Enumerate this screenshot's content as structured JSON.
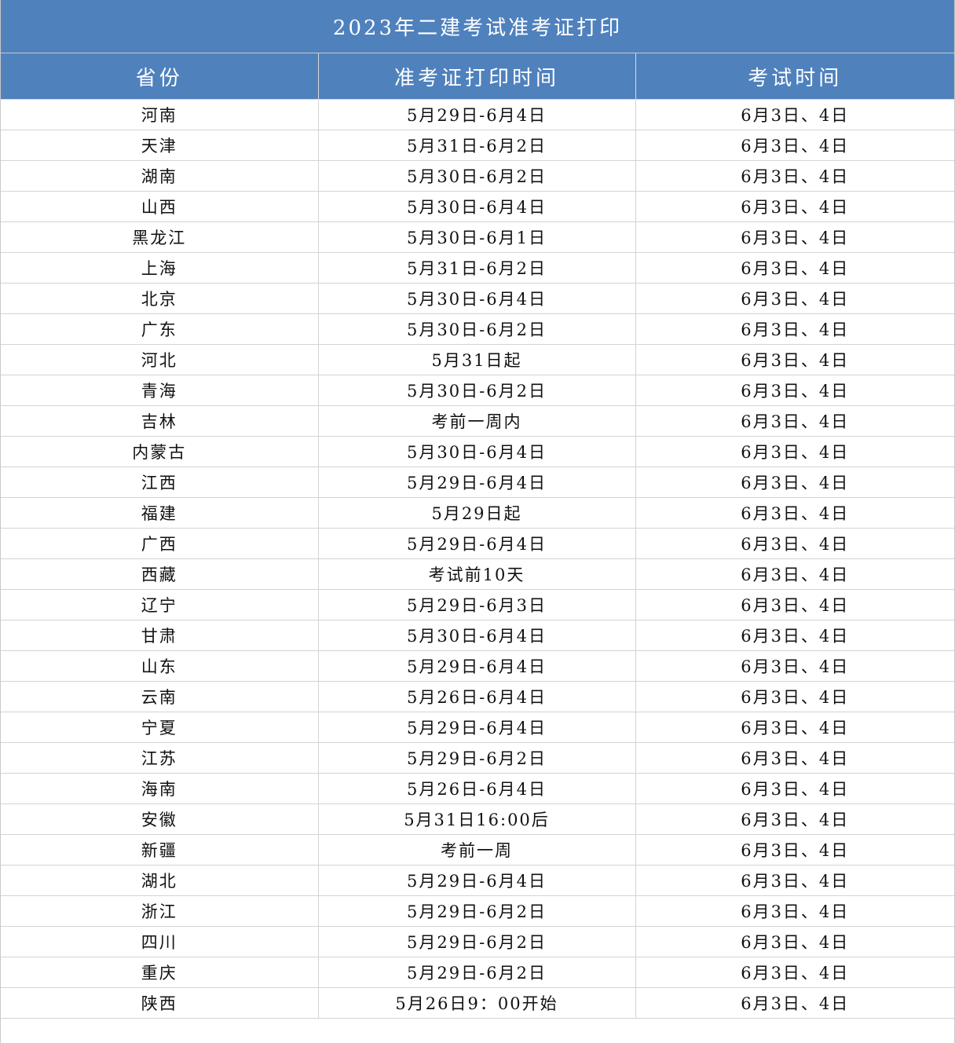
{
  "title": "2023年二建考试准考证打印",
  "headers": [
    "省份",
    "准考证打印时间",
    "考试时间"
  ],
  "rows": [
    [
      "河南",
      "5月29日-6月4日",
      "6月3日、4日"
    ],
    [
      "天津",
      "5月31日-6月2日",
      "6月3日、4日"
    ],
    [
      "湖南",
      "5月30日-6月2日",
      "6月3日、4日"
    ],
    [
      "山西",
      "5月30日-6月4日",
      "6月3日、4日"
    ],
    [
      "黑龙江",
      "5月30日-6月1日",
      "6月3日、4日"
    ],
    [
      "上海",
      "5月31日-6月2日",
      "6月3日、4日"
    ],
    [
      "北京",
      "5月30日-6月4日",
      "6月3日、4日"
    ],
    [
      "广东",
      "5月30日-6月2日",
      "6月3日、4日"
    ],
    [
      "河北",
      "5月31日起",
      "6月3日、4日"
    ],
    [
      "青海",
      "5月30日-6月2日",
      "6月3日、4日"
    ],
    [
      "吉林",
      "考前一周内",
      "6月3日、4日"
    ],
    [
      "内蒙古",
      "5月30日-6月4日",
      "6月3日、4日"
    ],
    [
      "江西",
      "5月29日-6月4日",
      "6月3日、4日"
    ],
    [
      "福建",
      "5月29日起",
      "6月3日、4日"
    ],
    [
      "广西",
      "5月29日-6月4日",
      "6月3日、4日"
    ],
    [
      "西藏",
      "考试前10天",
      "6月3日、4日"
    ],
    [
      "辽宁",
      "5月29日-6月3日",
      "6月3日、4日"
    ],
    [
      "甘肃",
      "5月30日-6月4日",
      "6月3日、4日"
    ],
    [
      "山东",
      "5月29日-6月4日",
      "6月3日、4日"
    ],
    [
      "云南",
      "5月26日-6月4日",
      "6月3日、4日"
    ],
    [
      "宁夏",
      "5月29日-6月4日",
      "6月3日、4日"
    ],
    [
      "江苏",
      "5月29日-6月2日",
      "6月3日、4日"
    ],
    [
      "海南",
      "5月26日-6月4日",
      "6月3日、4日"
    ],
    [
      "安徽",
      "5月31日16:00后",
      "6月3日、4日"
    ],
    [
      "新疆",
      "考前一周",
      "6月3日、4日"
    ],
    [
      "湖北",
      "5月29日-6月4日",
      "6月3日、4日"
    ],
    [
      "浙江",
      "5月29日-6月2日",
      "6月3日、4日"
    ],
    [
      "四川",
      "5月29日-6月2日",
      "6月3日、4日"
    ],
    [
      "重庆",
      "5月29日-6月2日",
      "6月3日、4日"
    ],
    [
      "陕西",
      "5月26日9：00开始",
      "6月3日、4日"
    ]
  ]
}
